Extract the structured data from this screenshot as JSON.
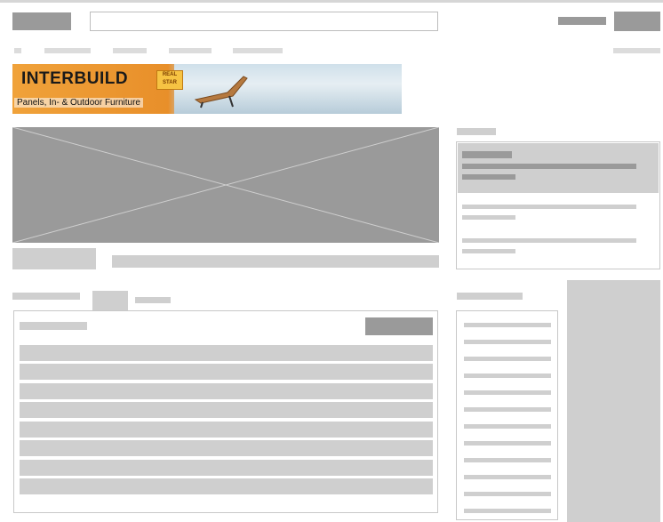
{
  "banner": {
    "brand": "INTERBUILD",
    "stamp": "REAL STAR",
    "tagline": "Panels, In- & Outdoor Furniture"
  },
  "colors": {
    "placeholder_dark": "#9a9a9a",
    "placeholder_mid": "#bdbdbd",
    "placeholder_light": "#cfcfcf",
    "border": "#c8c8c8",
    "banner_orange": "#e88f2a"
  }
}
